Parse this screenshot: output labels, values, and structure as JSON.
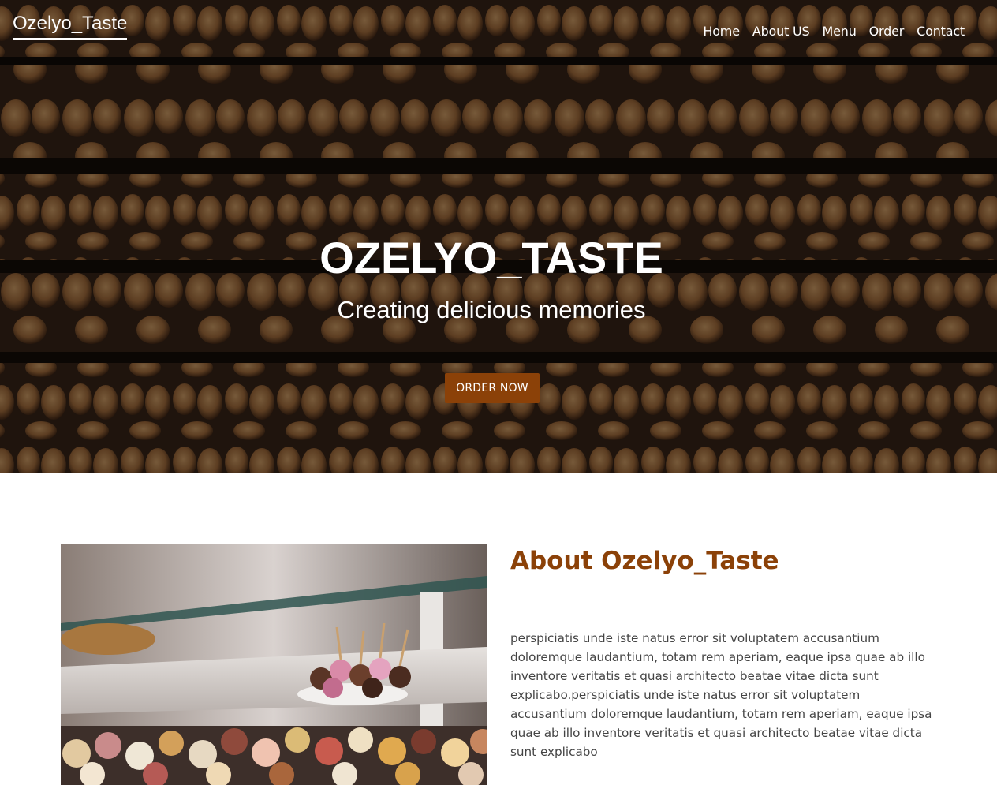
{
  "header": {
    "brand": "Ozelyo_Taste",
    "nav": [
      "Home",
      "About US",
      "Menu",
      "Order",
      "Contact"
    ]
  },
  "hero": {
    "title": "OZELYO_TASTE",
    "subtitle": "Creating delicious memories",
    "cta_label": "ORDER NOW"
  },
  "about": {
    "title": "About Ozelyo_Taste",
    "body": "perspiciatis unde iste natus error sit voluptatem accusantium doloremque laudantium, totam rem aperiam, eaque ipsa quae ab illo inventore veritatis et quasi architecto beatae vitae dicta sunt explicabo.perspiciatis unde iste natus error sit voluptatem accusantium doloremque laudantium, totam rem aperiam, eaque ipsa quae ab illo inventore veritatis et quasi architecto beatae vitae dicta sunt explicabo"
  },
  "colors": {
    "accent": "#8b4108",
    "text": "#444444",
    "hero_overlay": "#000000"
  },
  "icons": [
    "bakery-bread-shelves-photo",
    "pastry-display-case-photo"
  ]
}
